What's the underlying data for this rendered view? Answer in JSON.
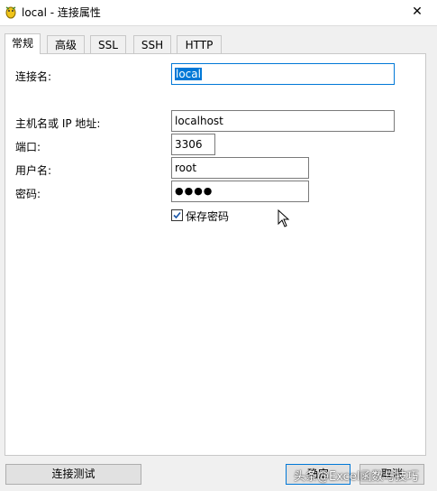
{
  "window": {
    "title": "local - 连接属性",
    "close_glyph": "✕"
  },
  "tabs": [
    {
      "label": "常规",
      "active": true
    },
    {
      "label": "高级",
      "active": false
    },
    {
      "label": "SSL",
      "active": false
    },
    {
      "label": "SSH",
      "active": false
    },
    {
      "label": "HTTP",
      "active": false
    }
  ],
  "form": {
    "connection_name": {
      "label": "连接名:",
      "value": "local"
    },
    "host": {
      "label": "主机名或 IP 地址:",
      "value": "localhost"
    },
    "port": {
      "label": "端口:",
      "value": "3306"
    },
    "username": {
      "label": "用户名:",
      "value": "root"
    },
    "password": {
      "label": "密码:",
      "value": "●●●●"
    },
    "save_password": {
      "label": "保存密码",
      "checked": true
    }
  },
  "buttons": {
    "test_connection": "连接测试",
    "ok": "确定",
    "cancel": "取消"
  },
  "watermark": "头条@Excel函数与技巧",
  "colors": {
    "accent": "#0078d7",
    "selection": "#0078d7"
  }
}
